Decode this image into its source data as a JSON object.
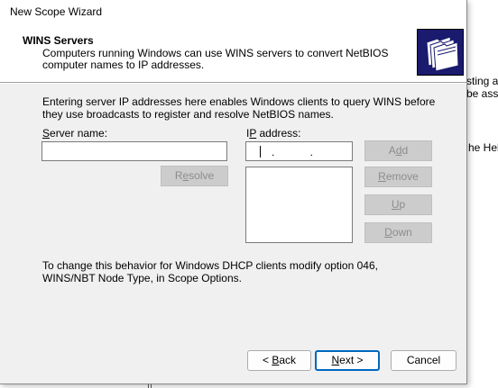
{
  "window": {
    "title": "New Scope Wizard"
  },
  "header": {
    "title": "WINS Servers",
    "subtitle": "Computers running Windows can use WINS servers to convert NetBIOS computer names to IP addresses.",
    "icon": "folder-stack-icon"
  },
  "body": {
    "intro": "Entering server IP addresses here enables Windows clients to query WINS before they use broadcasts to register and resolve NetBIOS names.",
    "server_name_label_pre": "",
    "server_name_label_key": "S",
    "server_name_label_post": "erver name:",
    "server_name_value": "",
    "ip_label_pre": "I",
    "ip_label_key": "P",
    "ip_label_post": " address:",
    "ip_value": ". . .",
    "ip_list": [],
    "footnote": "To change this behavior for Windows DHCP clients modify option 046, WINS/NBT Node Type, in Scope Options."
  },
  "buttons": {
    "resolve_pre": "R",
    "resolve_key": "e",
    "resolve_post": "solve",
    "add_pre": "A",
    "add_key": "d",
    "add_post": "d",
    "remove_pre": "",
    "remove_key": "R",
    "remove_post": "emove",
    "up_pre": "",
    "up_key": "U",
    "up_post": "p",
    "down_pre": "",
    "down_key": "D",
    "down_post": "own",
    "back_pre": "< ",
    "back_key": "B",
    "back_post": "ack",
    "next_pre": "",
    "next_key": "N",
    "next_post": "ext >",
    "cancel": "Cancel"
  },
  "background": {
    "line1": "sting a",
    "line2": "be assi",
    "line3": "he Help"
  },
  "colors": {
    "dialog_bg": "#f0f0f0",
    "header_bg": "#ffffff",
    "icon_bg": "#1a1a6e",
    "primary_border": "#0067c0",
    "disabled_text": "#8d8d8d"
  }
}
